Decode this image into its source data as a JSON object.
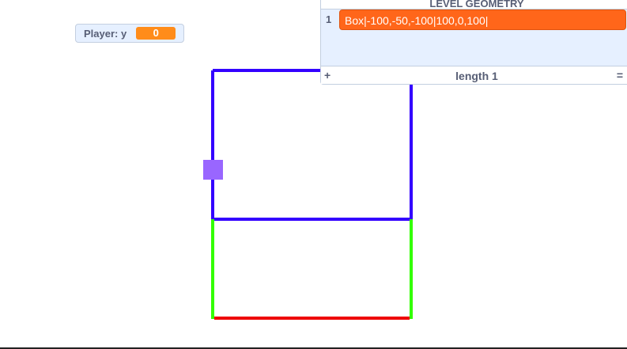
{
  "monitor": {
    "label": "Player: y",
    "value": "0",
    "accent": "#ff8c1a"
  },
  "list": {
    "title": "LEVEL GEOMETRY",
    "items": [
      {
        "index": "1",
        "value": "Box|-100,-50,-100|100,0,100|"
      }
    ],
    "add_label": "+",
    "length_label": "length 1",
    "resize_label": "="
  },
  "scene": {
    "colors": {
      "back_edges": "#3300ff",
      "near_edges": "#33ff00",
      "floor_edge": "#ee0000",
      "player": "#9966ff"
    }
  }
}
